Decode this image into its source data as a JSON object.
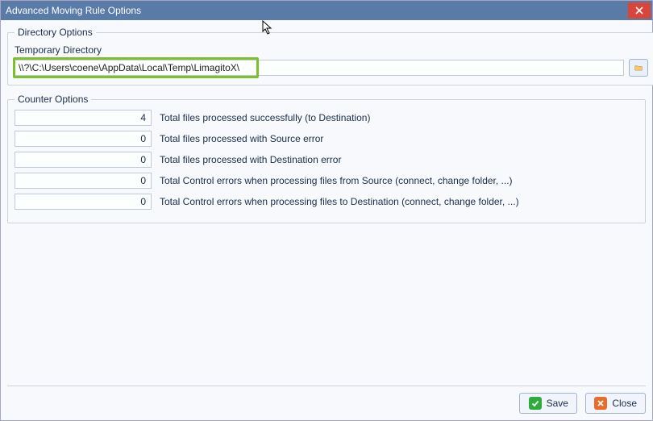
{
  "window": {
    "title": "Advanced Moving Rule Options"
  },
  "directory": {
    "group_label": "Directory Options",
    "temp_label": "Temporary Directory",
    "temp_value": "\\\\?\\C:\\Users\\coene\\AppData\\Local\\Temp\\LimagitoX\\"
  },
  "counters": {
    "group_label": "Counter Options",
    "rows": [
      {
        "value": "4",
        "desc": "Total files processed successfully (to Destination)"
      },
      {
        "value": "0",
        "desc": "Total files processed with Source error"
      },
      {
        "value": "0",
        "desc": "Total files processed with Destination error"
      },
      {
        "value": "0",
        "desc": "Total Control errors when processing files from Source (connect, change folder, ...)"
      },
      {
        "value": "0",
        "desc": "Total Control errors when processing files to Destination (connect, change folder, ...)"
      }
    ]
  },
  "buttons": {
    "save": "Save",
    "close": "Close"
  }
}
